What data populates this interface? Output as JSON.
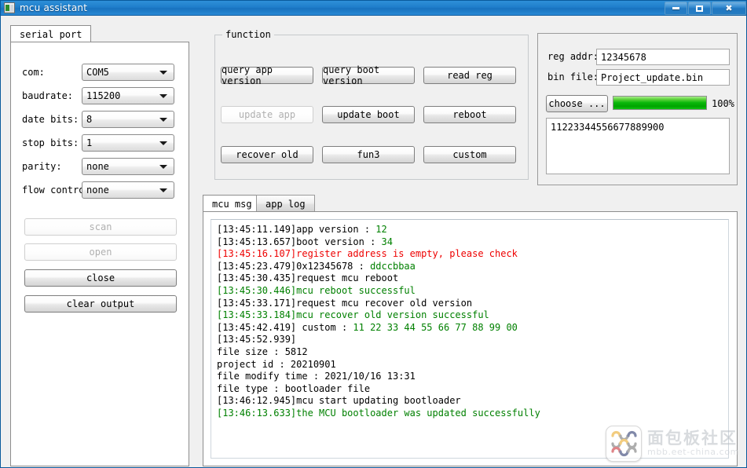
{
  "window": {
    "title": "mcu assistant",
    "icon": "app-icon",
    "buttons": {
      "minimize": "minimize-icon",
      "maximize": "maximize-icon",
      "close": "close-icon"
    }
  },
  "serial_panel": {
    "tab_label": "serial port",
    "fields": [
      {
        "label": "com:",
        "value": "COM5"
      },
      {
        "label": "baudrate:",
        "value": "115200"
      },
      {
        "label": "date bits:",
        "value": "8"
      },
      {
        "label": "stop bits:",
        "value": "1"
      },
      {
        "label": "parity:",
        "value": "none"
      },
      {
        "label": "flow control:",
        "value": "none"
      }
    ],
    "buttons": [
      {
        "label": "scan",
        "enabled": false
      },
      {
        "label": "open",
        "enabled": false
      },
      {
        "label": "close",
        "enabled": true
      },
      {
        "label": "clear output",
        "enabled": true
      }
    ]
  },
  "function_panel": {
    "title": "function",
    "buttons": [
      {
        "label": "query app version",
        "enabled": true
      },
      {
        "label": "query boot version",
        "enabled": true
      },
      {
        "label": "read reg",
        "enabled": true
      },
      {
        "label": "update app",
        "enabled": false
      },
      {
        "label": "update boot",
        "enabled": true
      },
      {
        "label": "reboot",
        "enabled": true
      },
      {
        "label": "recover old",
        "enabled": true
      },
      {
        "label": "fun3",
        "enabled": true
      },
      {
        "label": "custom",
        "enabled": true
      }
    ]
  },
  "file_panel": {
    "reg_addr_label": "reg addr:",
    "reg_addr_value": "12345678",
    "bin_file_label": "bin file:",
    "bin_file_value": "Project_update.bin",
    "choose_button": "choose ...",
    "progress_percent": "100%",
    "progress_value": 100,
    "progress_color": "#0bb80b",
    "data_value": "11223344556677889900"
  },
  "log_panel": {
    "tabs": [
      {
        "label": "mcu msg",
        "active": true
      },
      {
        "label": "app log",
        "active": false
      }
    ],
    "colors": {
      "default": "#000000",
      "green": "#008000",
      "red": "#ee0000"
    },
    "lines": [
      {
        "segments": [
          {
            "text": "[13:45:11.149]app version : ",
            "color": "#000000"
          },
          {
            "text": "12",
            "color": "#008000"
          }
        ]
      },
      {
        "segments": [
          {
            "text": "[13:45:13.657]boot version : ",
            "color": "#000000"
          },
          {
            "text": "34",
            "color": "#008000"
          }
        ]
      },
      {
        "segments": [
          {
            "text": "[13:45:16.107]register address is empty, please check",
            "color": "#ee0000"
          }
        ]
      },
      {
        "segments": [
          {
            "text": "[13:45:23.479]0x12345678 : ",
            "color": "#000000"
          },
          {
            "text": "ddccbbaa",
            "color": "#008000"
          }
        ]
      },
      {
        "segments": [
          {
            "text": "[13:45:30.435]request mcu reboot",
            "color": "#000000"
          }
        ]
      },
      {
        "segments": [
          {
            "text": "[13:45:30.446]mcu reboot successful",
            "color": "#008000"
          }
        ]
      },
      {
        "segments": [
          {
            "text": "[13:45:33.171]request mcu recover old version",
            "color": "#000000"
          }
        ]
      },
      {
        "segments": [
          {
            "text": "[13:45:33.184]mcu recover old version successful",
            "color": "#008000"
          }
        ]
      },
      {
        "segments": [
          {
            "text": "[13:45:42.419] custom : ",
            "color": "#000000"
          },
          {
            "text": "11 22 33 44 55 66 77 88 99 00",
            "color": "#008000"
          }
        ]
      },
      {
        "segments": [
          {
            "text": "[13:45:52.939]",
            "color": "#000000"
          }
        ]
      },
      {
        "segments": [
          {
            "text": "file size : 5812",
            "color": "#000000"
          }
        ]
      },
      {
        "segments": [
          {
            "text": "project id : 20210901",
            "color": "#000000"
          }
        ]
      },
      {
        "segments": [
          {
            "text": "file modify time : 2021/10/16 13:31",
            "color": "#000000"
          }
        ]
      },
      {
        "segments": [
          {
            "text": "file type : bootloader file",
            "color": "#000000"
          }
        ]
      },
      {
        "segments": [
          {
            "text": "[13:46:12.945]mcu start updating bootloader",
            "color": "#000000"
          }
        ]
      },
      {
        "segments": [
          {
            "text": "[13:46:13.633]the MCU bootloader was updated successfully",
            "color": "#008000"
          }
        ]
      }
    ]
  },
  "watermark": {
    "logo": "mbb-logo-icon",
    "cn_text": "面包板社区",
    "en_text": "mbb.eet-china.com"
  }
}
